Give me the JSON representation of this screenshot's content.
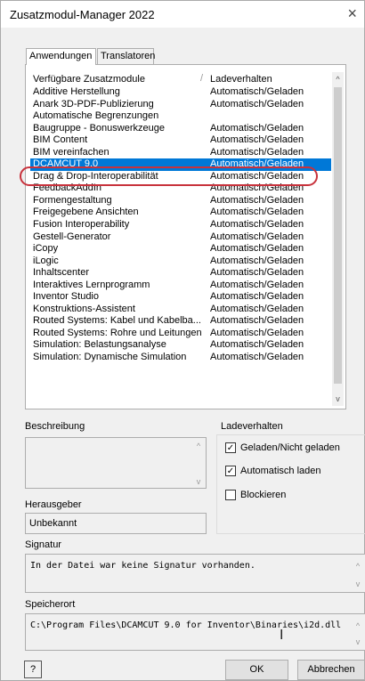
{
  "window": {
    "title": "Zusatzmodul-Manager 2022",
    "close_icon": "×"
  },
  "tabs": [
    {
      "label": "Anwendungen",
      "active": true
    },
    {
      "label": "Translatoren",
      "active": false
    }
  ],
  "list": {
    "header": {
      "name": "Verfügbare Zusatzmodule",
      "behavior": "Ladeverhalten"
    },
    "rows": [
      {
        "name": "Additive Herstellung",
        "behavior": "Automatisch/Geladen"
      },
      {
        "name": "Anark 3D-PDF-Publizierung",
        "behavior": "Automatisch/Geladen"
      },
      {
        "name": "Automatische Begrenzungen",
        "behavior": ""
      },
      {
        "name": "Baugruppe - Bonuswerkzeuge",
        "behavior": "Automatisch/Geladen"
      },
      {
        "name": "BIM Content",
        "behavior": "Automatisch/Geladen"
      },
      {
        "name": "BIM vereinfachen",
        "behavior": "Automatisch/Geladen"
      },
      {
        "name": "DCAMCUT 9.0",
        "behavior": "Automatisch/Geladen",
        "selected": true
      },
      {
        "name": "Drag & Drop-Interoperabilität",
        "behavior": "Automatisch/Geladen"
      },
      {
        "name": "FeedbackAddIn",
        "behavior": "Automatisch/Geladen"
      },
      {
        "name": "Formengestaltung",
        "behavior": "Automatisch/Geladen"
      },
      {
        "name": "Freigegebene Ansichten",
        "behavior": "Automatisch/Geladen"
      },
      {
        "name": "Fusion Interoperability",
        "behavior": "Automatisch/Geladen"
      },
      {
        "name": "Gestell-Generator",
        "behavior": "Automatisch/Geladen"
      },
      {
        "name": "iCopy",
        "behavior": "Automatisch/Geladen"
      },
      {
        "name": "iLogic",
        "behavior": "Automatisch/Geladen"
      },
      {
        "name": "Inhaltscenter",
        "behavior": "Automatisch/Geladen"
      },
      {
        "name": "Interaktives Lernprogramm",
        "behavior": "Automatisch/Geladen"
      },
      {
        "name": "Inventor Studio",
        "behavior": "Automatisch/Geladen"
      },
      {
        "name": "Konstruktions-Assistent",
        "behavior": "Automatisch/Geladen"
      },
      {
        "name": "Routed Systems: Kabel und Kabelba...",
        "behavior": "Automatisch/Geladen"
      },
      {
        "name": "Routed Systems: Rohre und Leitungen",
        "behavior": "Automatisch/Geladen"
      },
      {
        "name": "Simulation: Belastungsanalyse",
        "behavior": "Automatisch/Geladen"
      },
      {
        "name": "Simulation: Dynamische Simulation",
        "behavior": "Automatisch/Geladen"
      }
    ],
    "scroll_up_icon": "^",
    "scroll_down_icon": "v"
  },
  "beschreibung": {
    "label": "Beschreibung",
    "value": ""
  },
  "herausgeber": {
    "label": "Herausgeber",
    "value": "Unbekannt"
  },
  "ladeverhalten": {
    "label": "Ladeverhalten",
    "options": [
      {
        "label": "Geladen/Nicht geladen",
        "checked": true
      },
      {
        "label": "Automatisch laden",
        "checked": true
      },
      {
        "label": "Blockieren",
        "checked": false
      }
    ]
  },
  "signatur": {
    "label": "Signatur",
    "value": "In der Datei war keine Signatur vorhanden."
  },
  "speicherort": {
    "label": "Speicherort",
    "value": "C:\\Program Files\\DCAMCUT 9.0 for Inventor\\Binaries\\i2d.dll"
  },
  "buttons": {
    "help": "?",
    "ok": "OK",
    "cancel": "Abbrechen"
  },
  "colors": {
    "selection": "#0078d7",
    "highlight_oval": "#c8323c"
  },
  "check_mark": "✓",
  "cursor_glyph": "I"
}
